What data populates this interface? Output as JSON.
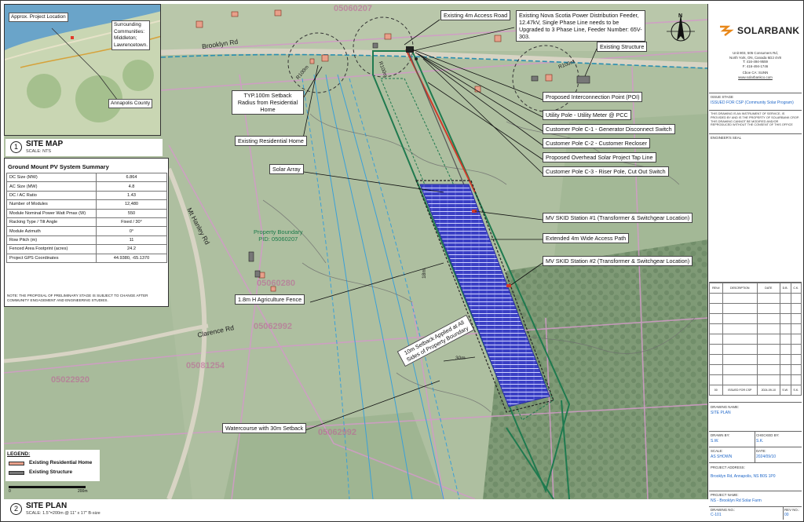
{
  "inset": {
    "labels": {
      "project_location": "Approx. Project Location",
      "communities": [
        "Surrounding",
        "Communities:",
        "Middleton;",
        "Lawrencetown."
      ],
      "county": "Annapolis County"
    }
  },
  "site_map_title": {
    "number": "1",
    "title": "SITE MAP",
    "scale": "SCALE: NTS"
  },
  "summary": {
    "title": "Ground Mount PV System Summary",
    "rows": [
      {
        "label": "DC Size (MW)",
        "value": "6.864"
      },
      {
        "label": "AC Size (MW)",
        "value": "4.8"
      },
      {
        "label": "DC / AC Ratio",
        "value": "1.43"
      },
      {
        "label": "Number of Modules",
        "value": "12,480"
      },
      {
        "label": "Module Nominal Power Watt Pmax (W)",
        "value": "550"
      },
      {
        "label": "Racking Type / Tilt Angle",
        "value": "Fixed / 30°"
      },
      {
        "label": "Module Azimuth",
        "value": "0°"
      },
      {
        "label": "Row Pitch (m)",
        "value": "11"
      },
      {
        "label": "Fenced Area Footprint (acres)",
        "value": "24.2"
      },
      {
        "label": "Project GPS Coordinates",
        "value": "44.9380, -65.1370"
      }
    ],
    "note": "NOTE: THE PROPOSAL OF PRELIMINARY STAGE IS SUBJECT TO CHANGE AFTER COMMUNITY ENGAGEMENT AND ENGINEERING STUDIES."
  },
  "legend": {
    "title": "LEGEND:",
    "items": [
      {
        "label": "Existing Residential Home",
        "color": "#e8a08a"
      },
      {
        "label": "Existing Structure",
        "color": "#777777"
      }
    ]
  },
  "scalebar": {
    "start": "0",
    "end": "200m"
  },
  "site_plan_title": {
    "number": "2",
    "title": "SITE PLAN",
    "scale": "SCALE: 1.5\"=200m @ 11\" x 17\" B-size"
  },
  "roads": {
    "brooklyn": "Brooklyn Rd",
    "mt_hanley": "Mt Hanley Rd",
    "clarence": "Clarence Rd"
  },
  "parcels": [
    "05060207",
    "05060280",
    "05062992",
    "05081254",
    "05022920",
    "05062992"
  ],
  "pid": {
    "line1": "Property Boundary",
    "line2": "PID: 05060207"
  },
  "dims": {
    "d100a": "R100m",
    "d100b": "R100m",
    "d30": "30m",
    "d18": "18m",
    "d100c": "R100m"
  },
  "callouts": {
    "access_road": "Existing 4m Access Road",
    "feeder": "Existing Nova Scotia Power Distribution Feeder, 12.47kV, Single Phase Line needs to be Upgraded to 3 Phase Line, Feeder Number: 65V-303.",
    "existing_structure": "Existing Structure",
    "setback_radius": "TYP.100m Setback Radius from Residential Home",
    "residential_home": "Existing Residential Home",
    "poi": "Proposed Interconnection Point (POI)",
    "utility_pole": "Utility Pole - Utility Meter @ PCC",
    "pole_c1": "Customer Pole C-1 - Generator Disconnect Switch",
    "pole_c2": "Customer Pole C-2 - Customer Recloser",
    "tap_line": "Proposed Overhead Solar Project Tap Line",
    "pole_c3": "Customer Pole C-3 - Riser Pole, Cut Out Switch",
    "solar_array": "Solar Array",
    "skid1": "MV SKID Station #1 (Transformer & Switchgear Location)",
    "access_path": "Extended 4m Wide Access Path",
    "skid2": "MV SKID Station #2 (Transformer & Switchgear Location)",
    "fence": "1.8m H Agriculture Fence",
    "setback10": "10m Setback Applied at All Sides of Property Boundary",
    "watercourse": "Watercourse with 30m Setback"
  },
  "titleblock": {
    "company": "SOLARBANK",
    "address": [
      "Unit 803, 505 Consumers Rd,",
      "North York, ON, Canada M2J 4V8",
      "T: 416-494-9559",
      "F: 416-494-1746",
      "Cboe CA: SUNN",
      "www.solarbankco.com"
    ],
    "issue_stage_label": "ISSUE STAGE",
    "issue_stage_value": "ISSUED FOR CSP (Community Solar Program)",
    "disclaimer": "THIS DRAWING IS AN INSTRUMENT OF SERVICE, IS PROVIDED BY AND IS THE PROPERTY OF SOLARBANK CROP. THIS DRAWING CANNOT BE MODIFIED AND/OR REPRODUCED WITHOUT THE CONSENT OF THIS OFFICE",
    "seal_label": "ENGINEER'S SEAL",
    "rev_headers": [
      "REV#",
      "DESCRIPTION",
      "DATE",
      "D.B.",
      "C.K."
    ],
    "rev_row": [
      "00",
      "ISSUED FOR CSP",
      "2024-09-10",
      "S.W.",
      "S.K."
    ],
    "drawing_name_label": "DRAWING NAME:",
    "drawing_name_value": "SITE PLAN",
    "drawn_by_label": "DRAWN BY:",
    "drawn_by_value": "S.W.",
    "checked_by_label": "CHECKED BY:",
    "checked_by_value": "S.K.",
    "scale_label": "SCALE:",
    "scale_value": "AS SHOWN",
    "date_label": "DATE:",
    "date_value": "2024/09/10",
    "project_address_label": "PROJECT ADDRESS:",
    "project_address_value": "Brooklyn Rd, Annapolis, NS B0S 1P0",
    "project_name_label": "PROJECT NAME:",
    "project_name_value": "NS - Brooklyn Rd Solar Farm",
    "drawing_no_label": "DRAWING NO.:",
    "drawing_no_value": "C-101",
    "rev_no_label": "REV NO.:",
    "rev_no_value": "00"
  },
  "colors": {
    "field": "#aebfa0",
    "forest": "#7f9a76",
    "road": "#d8d4c4",
    "boundary": "#1f7a4f",
    "feeder": "#2a8fb0",
    "panel": "#3a3fc4",
    "watercourse": "#3aa0d8",
    "parcel": "#d39ac9",
    "accent": "#1e66c8"
  },
  "icons": [
    "north-arrow-icon",
    "solarbank-logo-icon"
  ]
}
